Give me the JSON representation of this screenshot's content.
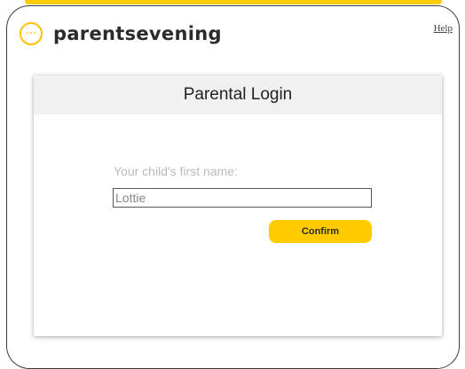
{
  "header": {
    "logo_icon": "ellipsis-circle-icon",
    "logo_glyph": "···",
    "brand": "parentsevening",
    "help_label": "Help"
  },
  "login": {
    "title": "Parental Login",
    "field_label": "Your child's first name:",
    "field_value": "Lottie",
    "confirm_label": "Confirm"
  },
  "colors": {
    "accent": "#ffcc00",
    "card_header_bg": "#f0f0f0",
    "label_text": "#bbbbbb"
  }
}
